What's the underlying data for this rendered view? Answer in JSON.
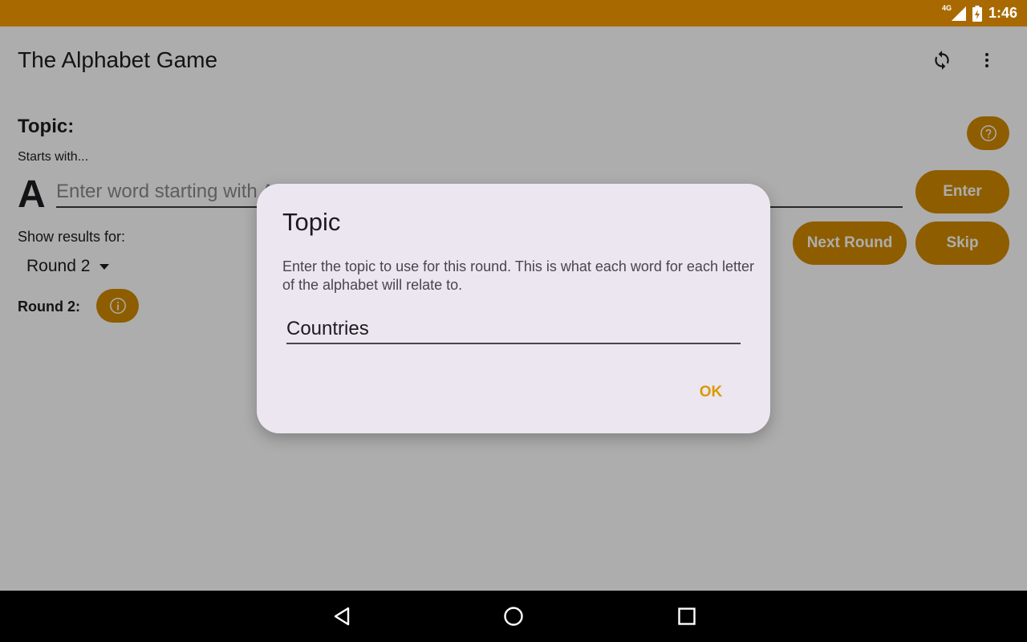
{
  "status_bar": {
    "network": "4G",
    "time": "1:46"
  },
  "app_bar": {
    "title": "The Alphabet Game",
    "refresh_icon": "refresh-icon",
    "more_icon": "more-vert-icon"
  },
  "game": {
    "topic_label": "Topic:",
    "starts_with_label": "Starts with...",
    "current_letter": "A",
    "word_input_placeholder": "Enter word starting with A",
    "enter_label": "Enter",
    "next_round_label": "Next Round",
    "skip_label": "Skip",
    "help_icon": "help-circle-icon"
  },
  "results": {
    "show_results_label": "Show results for:",
    "selected_round": "Round 2",
    "round_label": "Round 2:",
    "info_icon": "info-icon"
  },
  "dialog": {
    "title": "Topic",
    "message": "Enter the topic to use for this round. This is what each word for each letter of the alphabet will relate to.",
    "input_value": "Countries",
    "ok_label": "OK"
  },
  "colors": {
    "status_bar": "#a86a00",
    "accent": "#d18a00",
    "dialog_bg": "#ece6f0",
    "ok_text": "#d99a00"
  }
}
